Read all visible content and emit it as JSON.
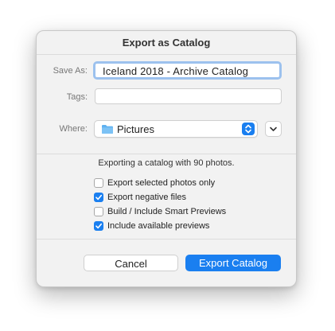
{
  "dialog": {
    "title": "Export as Catalog"
  },
  "form": {
    "save_as_label": "Save As:",
    "save_as_value": "Iceland 2018 - Archive Catalog",
    "tags_label": "Tags:",
    "tags_value": "",
    "where_label": "Where:",
    "where_value": "Pictures",
    "where_icon": "folder-icon"
  },
  "info": {
    "text": "Exporting a catalog with 90 photos."
  },
  "options": [
    {
      "label": "Export selected photos only",
      "checked": false
    },
    {
      "label": "Export negative files",
      "checked": true
    },
    {
      "label": "Build / Include Smart Previews",
      "checked": false
    },
    {
      "label": "Include available previews",
      "checked": true
    }
  ],
  "buttons": {
    "cancel_label": "Cancel",
    "export_label": "Export Catalog"
  },
  "colors": {
    "accent": "#1a7ff0",
    "focus_ring": "#9cc1ee",
    "folder": "#5fb1f0"
  }
}
